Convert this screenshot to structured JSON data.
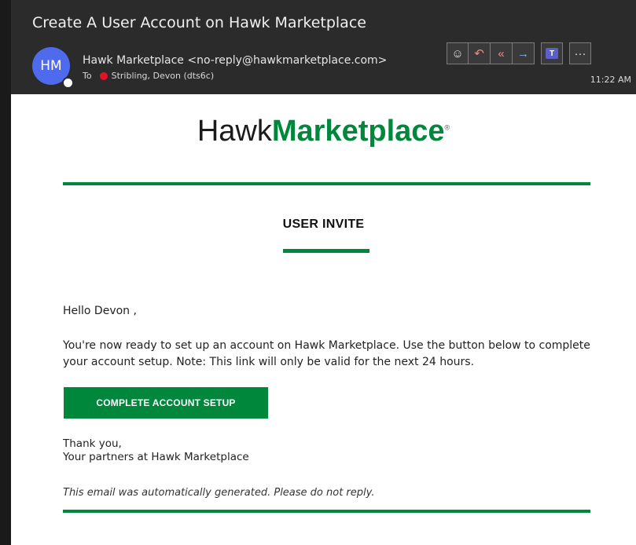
{
  "header": {
    "subject": "Create A User Account on Hawk Marketplace",
    "avatar_initials": "HM",
    "sender": "Hawk Marketplace <no-reply@hawkmarketplace.com>",
    "to_label": "To",
    "recipient": "Stribling, Devon (dts6c)",
    "time": "11:22 AM",
    "actions": {
      "emoji": "☺",
      "reply": "↶",
      "reply_all": "«",
      "forward": "→",
      "teams": "T",
      "more": "···"
    }
  },
  "email": {
    "logo_part1": "Hawk",
    "logo_part2": "Marketplace",
    "logo_reg": "®",
    "invite_title": "USER INVITE",
    "greeting": "Hello Devon ,",
    "paragraph": "You're now ready to set up an account on Hawk Marketplace. Use the button below to complete your account setup. Note: This link will only be valid for the next 24 hours.",
    "cta_label": "COMPLETE ACCOUNT SETUP",
    "thanks_line1": "Thank you,",
    "thanks_line2": "Your partners at Hawk Marketplace",
    "auto_note": "This email was automatically generated. Please do not reply."
  },
  "colors": {
    "brand_green": "#00873c",
    "avatar_blue": "#4f6bed",
    "presence_red": "#e81123"
  }
}
